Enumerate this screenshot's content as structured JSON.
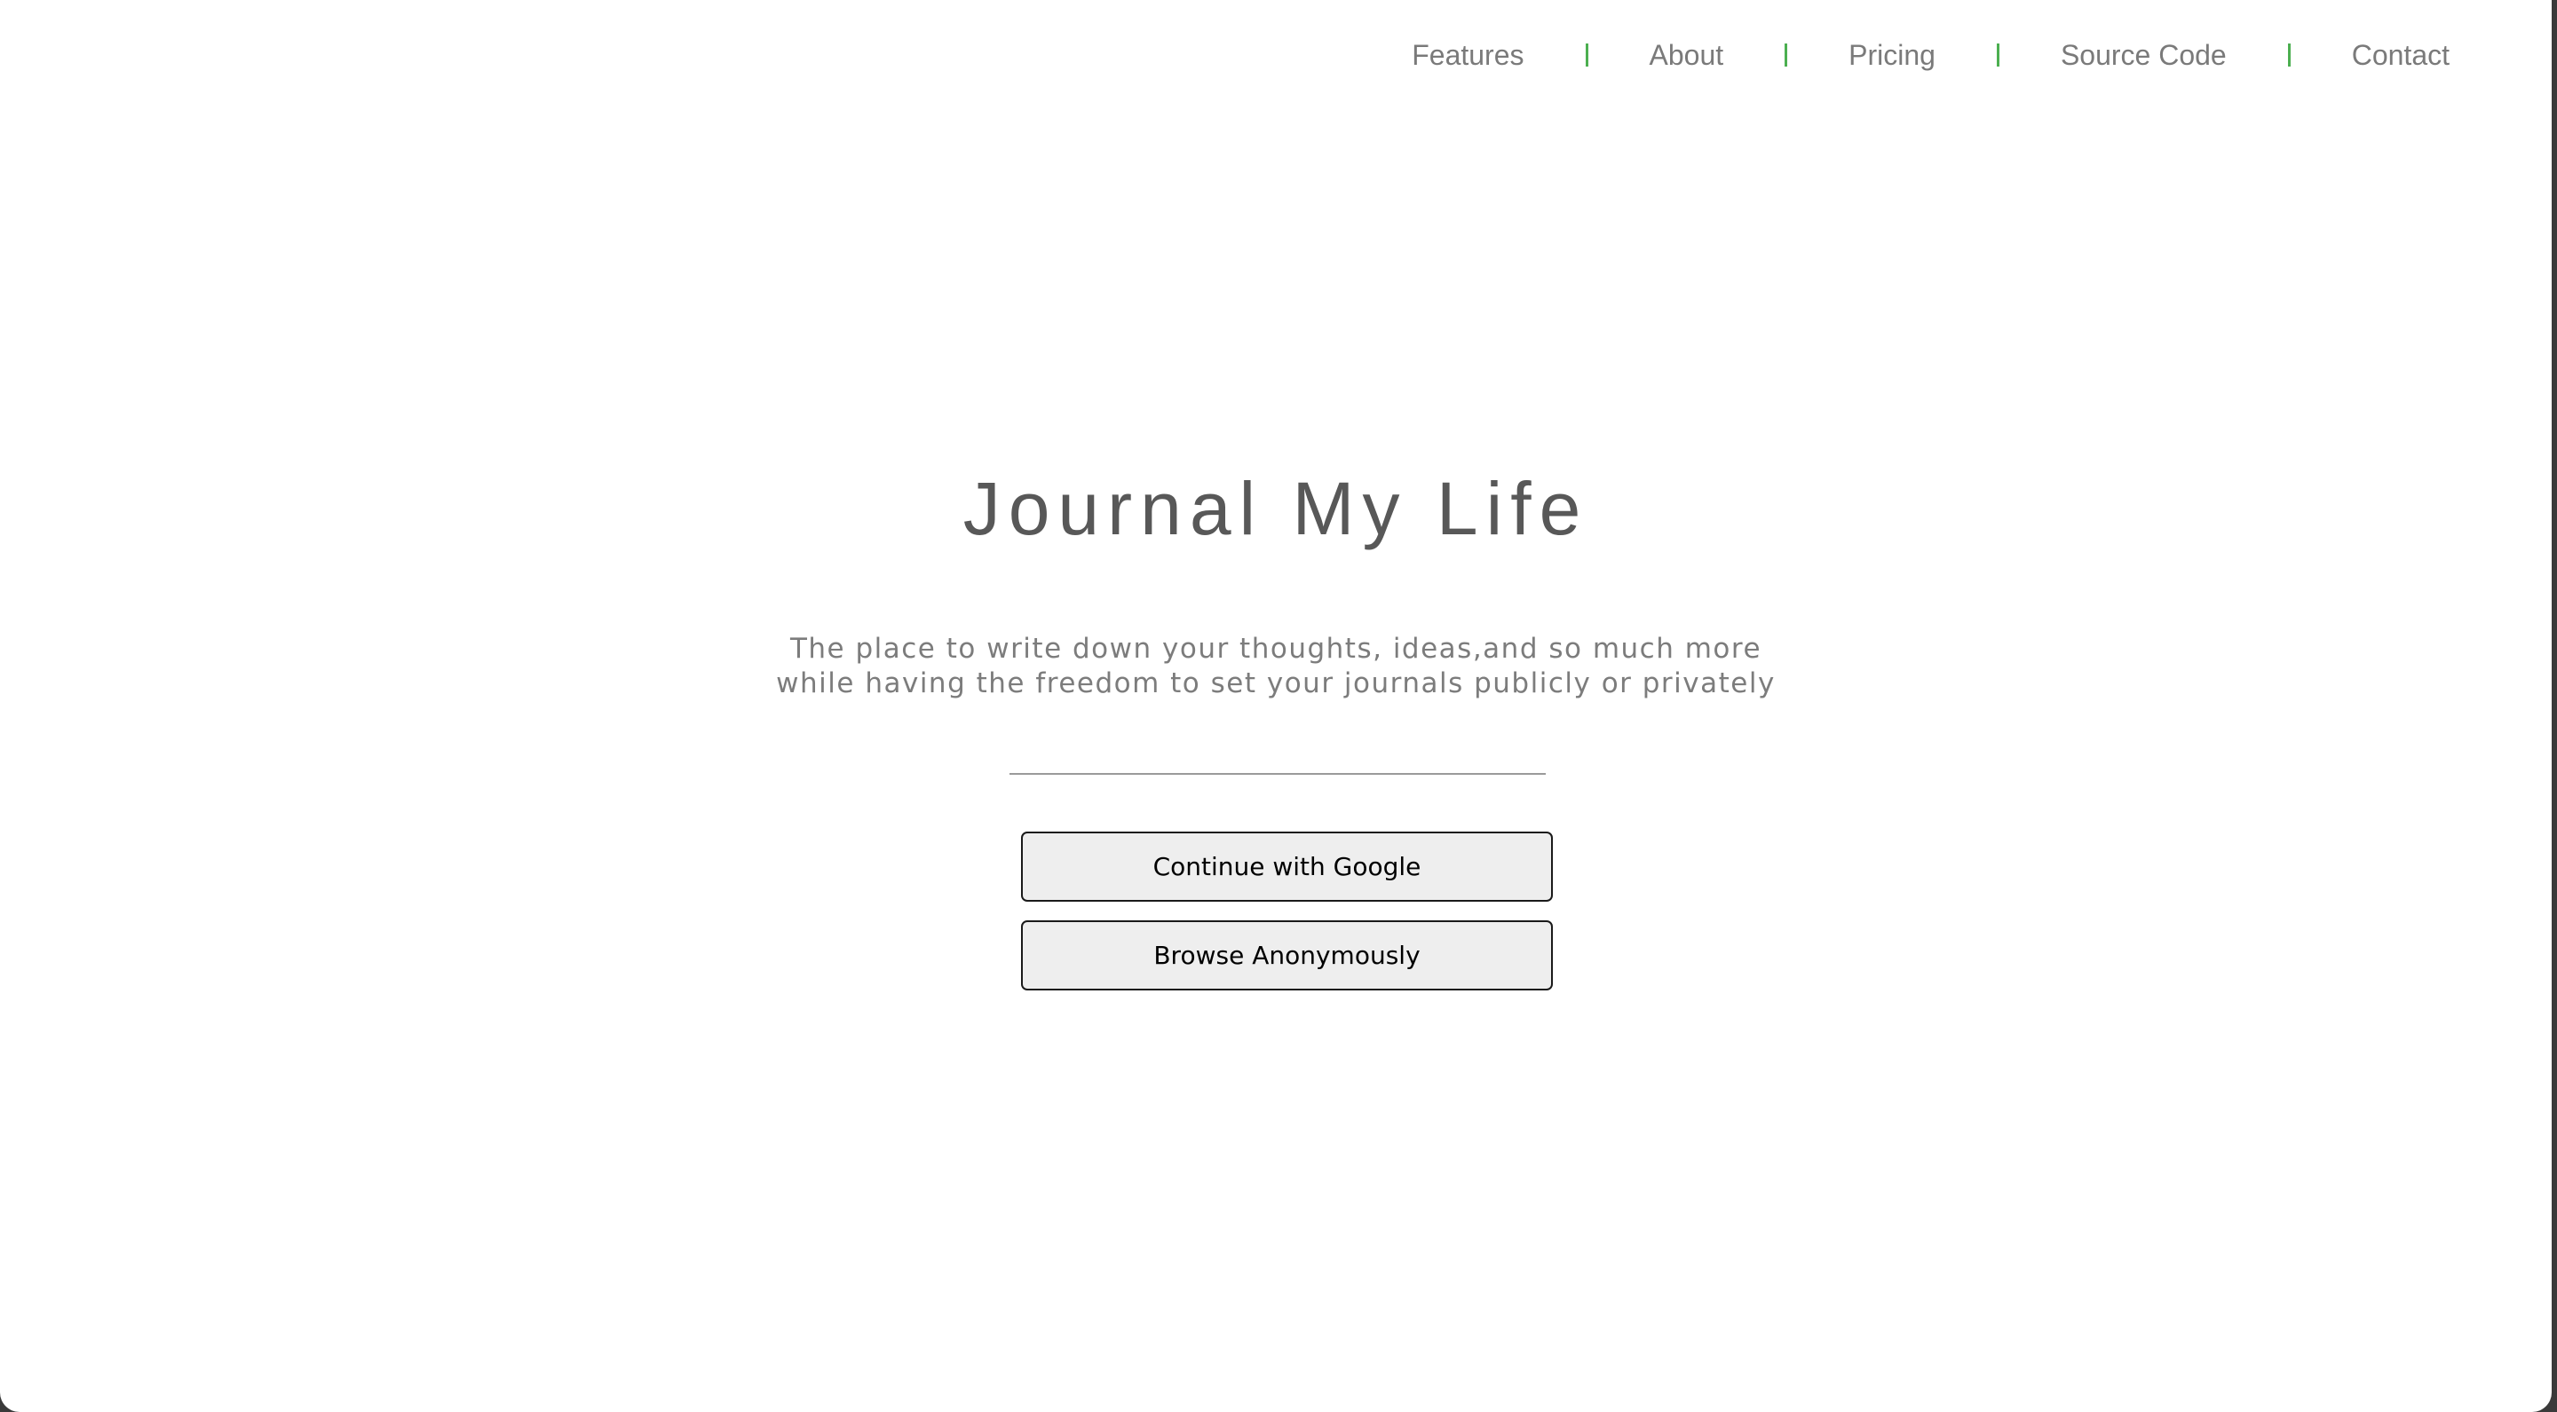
{
  "nav": {
    "items": [
      {
        "label": "Features"
      },
      {
        "label": "About"
      },
      {
        "label": "Pricing"
      },
      {
        "label": "Source Code"
      },
      {
        "label": "Contact"
      }
    ],
    "separator_color": "#4caf50"
  },
  "hero": {
    "title": "Journal My Life",
    "subtitle_line1": "The place to write down your thoughts, ideas,and so much more",
    "subtitle_line2": "while having the freedom to set your journals publicly or privately"
  },
  "actions": {
    "google_label": "Continue with Google",
    "anonymous_label": "Browse Anonymously"
  }
}
